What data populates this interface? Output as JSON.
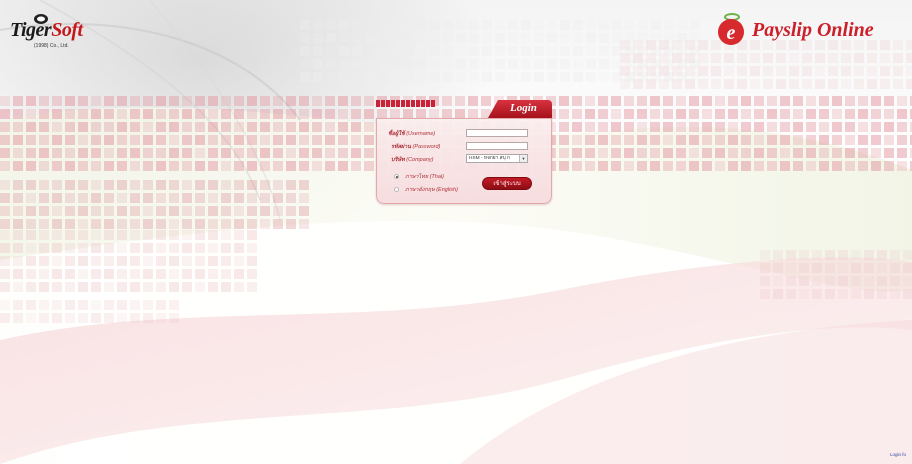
{
  "header": {
    "logo_main": "Tiger",
    "logo_accent": "Soft",
    "logo_sub": "(1998) Co., Ltd.",
    "brand": "Payslip Online"
  },
  "login": {
    "title": "Login",
    "username_label_th": "ชื่อผู้ใช้",
    "username_label_en": "(Username)",
    "password_label_th": "รหัสผ่าน",
    "password_label_en": "(Password)",
    "company_label_th": "บริษัท",
    "company_label_en": "(Company)",
    "username_value": "",
    "password_value": "",
    "company_selected": "HSM - หจกยา สบุ ก",
    "lang_thai": "ภาษาไทย (Thai)",
    "lang_english": "ภาษาอังกฤษ (English)",
    "submit_label": "เข้าสู่ระบบ"
  },
  "footer": {
    "link": "Login fo"
  },
  "colors": {
    "accent": "#c4161c",
    "panel_bg": "#f8e2e4"
  }
}
